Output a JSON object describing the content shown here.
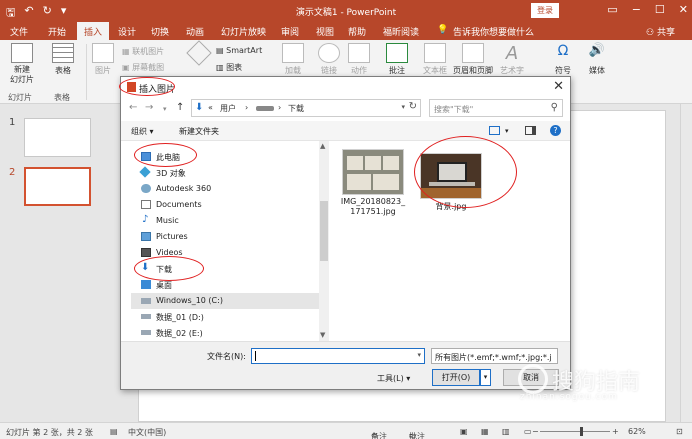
{
  "colors": {
    "accent": "#b7472a",
    "link_blue": "#1e6fc7",
    "annotation_red": "#e02020"
  },
  "titlebar": {
    "title": "演示文稿1 - PowerPoint",
    "login_label": "登录",
    "qa_icons": [
      "save-icon",
      "undo-icon",
      "redo-icon",
      "customize-icon"
    ]
  },
  "tabs": [
    {
      "label": "文件"
    },
    {
      "label": "开始"
    },
    {
      "label": "插入",
      "active": true
    },
    {
      "label": "设计"
    },
    {
      "label": "切换"
    },
    {
      "label": "动画"
    },
    {
      "label": "幻灯片放映"
    },
    {
      "label": "审阅"
    },
    {
      "label": "视图"
    },
    {
      "label": "帮助"
    },
    {
      "label": "福昕阅读"
    },
    {
      "label": "告诉我你想要做什么"
    },
    {
      "label": "共享"
    }
  ],
  "ribbon": {
    "new_slide": "新建\n幻灯片",
    "table": "表格",
    "picture": "图片",
    "online_picture": "联机图片",
    "screenshot": "屏幕截图",
    "smartart": "SmartArt",
    "chart": "图表",
    "add_in": "加载",
    "link": "链接",
    "action": "动作",
    "comment": "批注",
    "textbox": "文本框",
    "header_footer": "页眉和页脚",
    "wordart": "艺术字",
    "symbol": "符号",
    "media": "媒体",
    "group_slides": "幻灯片",
    "group_table": "表格"
  },
  "slides": {
    "items": [
      {
        "num": "1"
      },
      {
        "num": "2",
        "selected": true
      }
    ]
  },
  "dialog": {
    "title": "插入图片",
    "address": {
      "prefix": "«",
      "seg1": "用户",
      "sep": "›",
      "seg3": "下载"
    },
    "search_placeholder": "搜索\"下载\"",
    "organize": "组织 ▾",
    "new_folder": "新建文件夹",
    "help": "?",
    "tree": [
      {
        "label": "此电脑",
        "icon": "computer-icon"
      },
      {
        "label": "3D 对象",
        "icon": "3d-objects-icon"
      },
      {
        "label": "Autodesk 360",
        "icon": "cloud-icon"
      },
      {
        "label": "Documents",
        "icon": "documents-icon"
      },
      {
        "label": "Music",
        "icon": "music-icon"
      },
      {
        "label": "Pictures",
        "icon": "pictures-icon"
      },
      {
        "label": "Videos",
        "icon": "videos-icon"
      },
      {
        "label": "下载",
        "icon": "download-icon"
      },
      {
        "label": "桌面",
        "icon": "desktop-icon"
      },
      {
        "label": "Windows_10 (C:)",
        "icon": "drive-icon",
        "selected": true
      },
      {
        "label": "数据_01 (D:)",
        "icon": "drive-icon"
      },
      {
        "label": "数据_02 (E:)",
        "icon": "drive-icon"
      }
    ],
    "files": [
      {
        "name": "IMG_20180823_\n171751.jpg"
      },
      {
        "name": "背景.jpg"
      }
    ],
    "filename_label": "文件名(N):",
    "filename_value": "",
    "filter": "所有图片(*.emf;*.wmf;*.jpg;*.j",
    "tools": "工具(L)  ▾",
    "open": "打开(O)",
    "cancel": "取消"
  },
  "statusbar": {
    "slide_info": "幻灯片 第 2 张，共 2 张",
    "language": "中文(中国)",
    "notes": "备注",
    "comments": "批注",
    "zoom": "62%"
  },
  "watermark": {
    "text": "搜狗指南",
    "url": "zhinan.sogou.com"
  }
}
